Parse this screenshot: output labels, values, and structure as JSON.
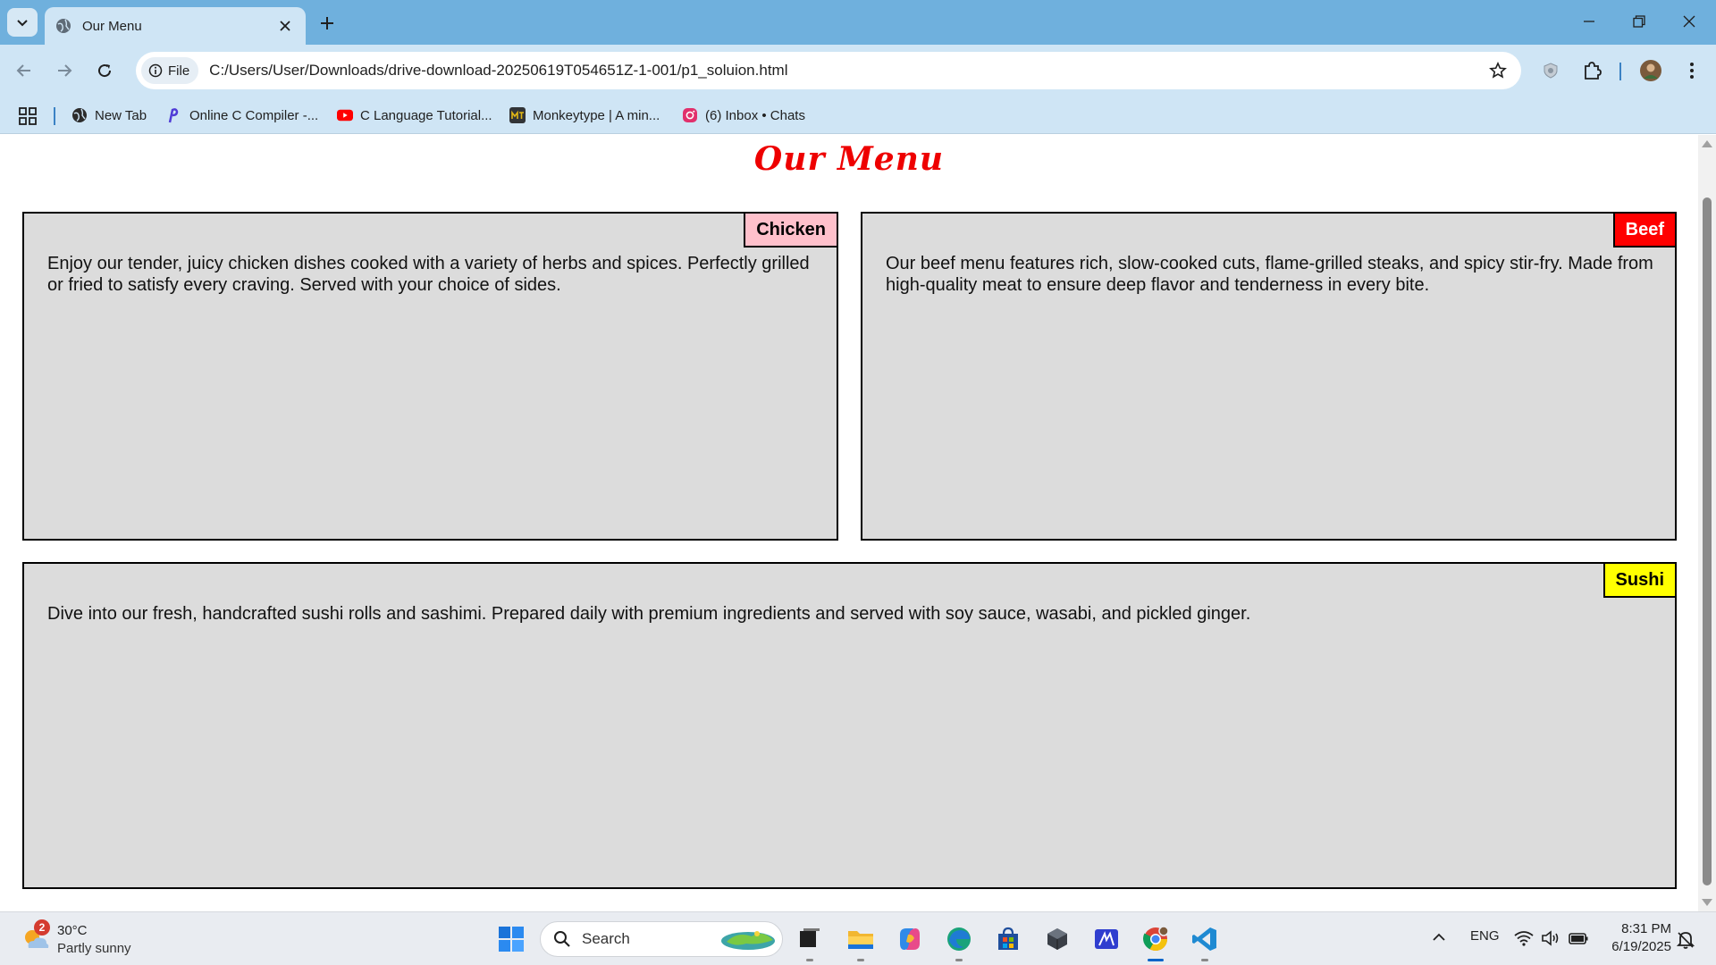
{
  "browser": {
    "tab_title": "Our Menu",
    "file_chip": "File",
    "url": "C:/Users/User/Downloads/drive-download-20250619T054651Z-1-001/p1_soluion.html",
    "bookmarks": [
      {
        "label": "New Tab",
        "icon": "globe-icon"
      },
      {
        "label": "Online C Compiler -...",
        "icon": "compiler-icon"
      },
      {
        "label": "C Language Tutorial...",
        "icon": "youtube-icon"
      },
      {
        "label": "Monkeytype | A min...",
        "icon": "monkeytype-icon"
      },
      {
        "label": "(6) Inbox • Chats",
        "icon": "instagram-icon"
      }
    ]
  },
  "page": {
    "title": "Our Menu",
    "title_color": "#ee0000",
    "cards": [
      {
        "badge": "Chicken",
        "badge_bg": "#ffc0cb",
        "badge_color": "#000000",
        "text": "Enjoy our tender, juicy chicken dishes cooked with a variety of herbs and spices. Perfectly grilled or fried to satisfy every craving. Served with your choice of sides."
      },
      {
        "badge": "Beef",
        "badge_bg": "#ff0000",
        "badge_color": "#ffffff",
        "text": "Our beef menu features rich, slow-cooked cuts, flame-grilled steaks, and spicy stir-fry. Made from high-quality meat to ensure deep flavor and tenderness in every bite."
      },
      {
        "badge": "Sushi",
        "badge_bg": "#ffff00",
        "badge_color": "#000000",
        "text": "Dive into our fresh, handcrafted sushi rolls and sashimi. Prepared daily with premium ingredients and served with soy sauce, wasabi, and pickled ginger."
      }
    ]
  },
  "taskbar": {
    "weather_badge": "2",
    "weather_temp": "30°C",
    "weather_desc": "Partly sunny",
    "search_label": "Search",
    "language": "ENG",
    "time": "8:31 PM",
    "date": "6/19/2025"
  }
}
